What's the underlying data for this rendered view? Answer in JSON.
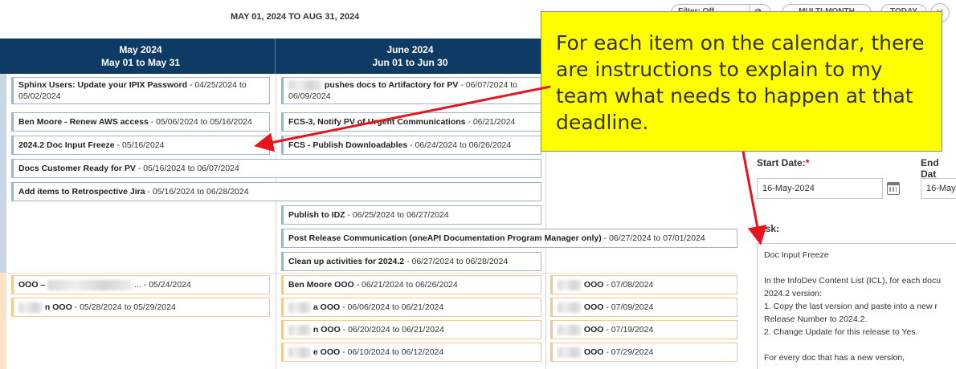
{
  "header": {
    "date_range": "MAY 01, 2024 TO AUG 31, 2024",
    "filter_label": "Filter: Off",
    "multi_month_label": "MULTI-MONTH",
    "today_label": "TODAY",
    "close_icon": "close-icon"
  },
  "months": [
    {
      "title": "May 2024",
      "range": "May 01 to May 31"
    },
    {
      "title": "June 2024",
      "range": "Jun 01 to Jun 30"
    }
  ],
  "events": [
    {
      "title": "Sphinx Users: Update your IPIX Password",
      "dates": " - 04/25/2024 to 05/02/2024"
    },
    {
      "title": "Ben Moore - Renew AWS access",
      "dates": " - 05/06/2024 to 05/16/2024"
    },
    {
      "title": "2024.2 Doc Input Freeze",
      "dates": " - 05/16/2024"
    },
    {
      "title": "Docs Customer Ready for PV",
      "dates": " - 05/16/2024 to 06/07/2024"
    },
    {
      "title": "Add items to Retrospective Jira",
      "dates": " - 05/16/2024 to 06/28/2024"
    },
    {
      "title": "pushes docs to Artifactory for PV",
      "dates": " - 06/07/2024 to 06/09/2024"
    },
    {
      "title": "FCS-3, Notify PV of Urgent Communications",
      "dates": " - 06/21/2024"
    },
    {
      "title": "FCS - Publish Downloadables",
      "dates": " - 06/24/2024 to 06/26/2024"
    },
    {
      "title": "Publish to IDZ",
      "dates": " - 06/25/2024 to 06/27/2024"
    },
    {
      "title": "Post Release Communication (oneAPI Documentation Program Manager only)",
      "dates": " - 06/27/2024 to 07/01/2024"
    },
    {
      "title": "Clean up activities for 2024.2",
      "dates": " - 06/27/2024 to 06/28/2024"
    }
  ],
  "ooo_events": [
    {
      "title": "OOO –",
      "dates": " ... - 05/24/2024"
    },
    {
      "title": "n OOO",
      "dates": " - 05/28/2024 to 05/29/2024"
    },
    {
      "title": "Ben Moore OOO",
      "dates": " - 06/21/2024 to 06/26/2024"
    },
    {
      "title": "a OOO",
      "dates": " - 06/06/2024 to 06/21/2024"
    },
    {
      "title": "n OOO",
      "dates": " - 06/20/2024 to 06/21/2024"
    },
    {
      "title": "e OOO",
      "dates": " - 06/10/2024 to 06/12/2024"
    },
    {
      "title": "OOO",
      "dates": " - 07/08/2024"
    },
    {
      "title": "OOO",
      "dates": " - 07/09/2024"
    },
    {
      "title": "OOO",
      "dates": " - 07/19/2024"
    },
    {
      "title": "OOO",
      "dates": " - 07/29/2024"
    }
  ],
  "callout": {
    "text": "For each item on the calendar, there are instructions to explain to my team what needs to happen at that deadline."
  },
  "panel": {
    "start_label": "Start Date:",
    "required_mark": "*",
    "end_label": "End Dat",
    "start_value": "16-May-2024",
    "end_value": "16-May",
    "task_label": "ask:",
    "task_text": "Doc Input Freeze\n\nIn the InfoDev Content List (ICL), for each docu\n2024.2 version:\n1. Copy the last version and paste into a new r\nRelease Number to 2024.2.\n2. Change Update for this release to Yes.\n\nFor every doc that has a new version,"
  },
  "colors": {
    "header_bg": "#0e3a66",
    "callout_bg": "#ffff00",
    "arrow": "#e8141d",
    "ooo_border": "#f2c98f"
  }
}
